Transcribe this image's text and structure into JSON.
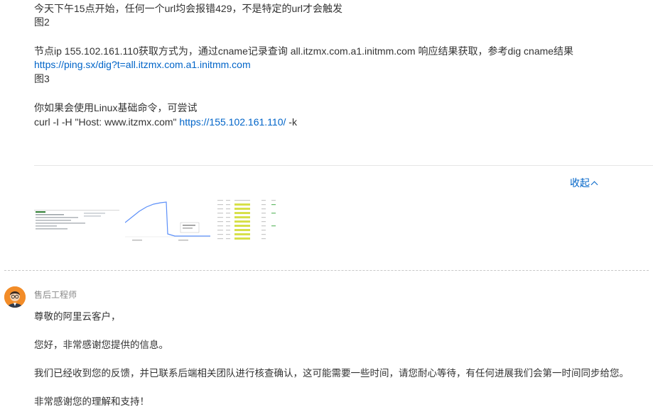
{
  "ticket": {
    "line1": "今天下午15点开始，任何一个url均会报错429，不是特定的url才会触发",
    "line2": "图2",
    "line3": "节点ip 155.102.161.110获取方式为，通过cname记录查询 all.itzmx.com.a1.initmm.com 响应结果获取，参考dig cname结果",
    "line4_link": "https://ping.sx/dig?t=all.itzmx.com.a1.initmm.com",
    "line5": "图3",
    "line6": "你如果会使用Linux基础命令，可尝试",
    "curl_prefix": "curl -I -H \"Host: www.itzmx.com\" ",
    "curl_link": "https://155.102.161.110/",
    "curl_suffix": " -k"
  },
  "collapse_label": "收起",
  "thumbnails": [
    {
      "name": "attachment-thumbnail-1"
    },
    {
      "name": "attachment-thumbnail-2"
    },
    {
      "name": "attachment-thumbnail-3"
    }
  ],
  "reply": {
    "author": "售后工程师",
    "avatar_icon": "engineer-avatar-icon",
    "p1": "尊敬的阿里云客户，",
    "p2": "您好，非常感谢您提供的信息。",
    "p3": "我们已经收到您的反馈，并已联系后端相关团队进行核查确认，这可能需要一些时间，请您耐心等待，有任何进展我们会第一时间同步给您。",
    "p4": "非常感谢您的理解和支持！"
  },
  "colors": {
    "link": "#0064c8",
    "text": "#333333",
    "muted": "#888888",
    "avatar_bg": "#f28c28"
  }
}
